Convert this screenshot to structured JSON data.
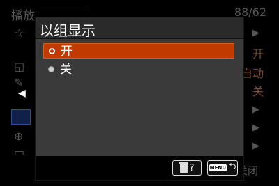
{
  "background": {
    "title": "播放",
    "page": "88/62",
    "right_values": [
      "开",
      "自动",
      "关"
    ],
    "close_label": "关闭"
  },
  "dialog": {
    "title": "以组显示",
    "options": [
      {
        "label": "开",
        "selected": true
      },
      {
        "label": "关",
        "selected": false
      }
    ],
    "footer": {
      "trash_icon": "trash-icon",
      "help": "?",
      "menu_label": "MENU",
      "back_icon": "back-arrow-icon"
    }
  },
  "colors": {
    "highlight": "#c13a00",
    "dialog_bg": "#3a3a3a"
  }
}
